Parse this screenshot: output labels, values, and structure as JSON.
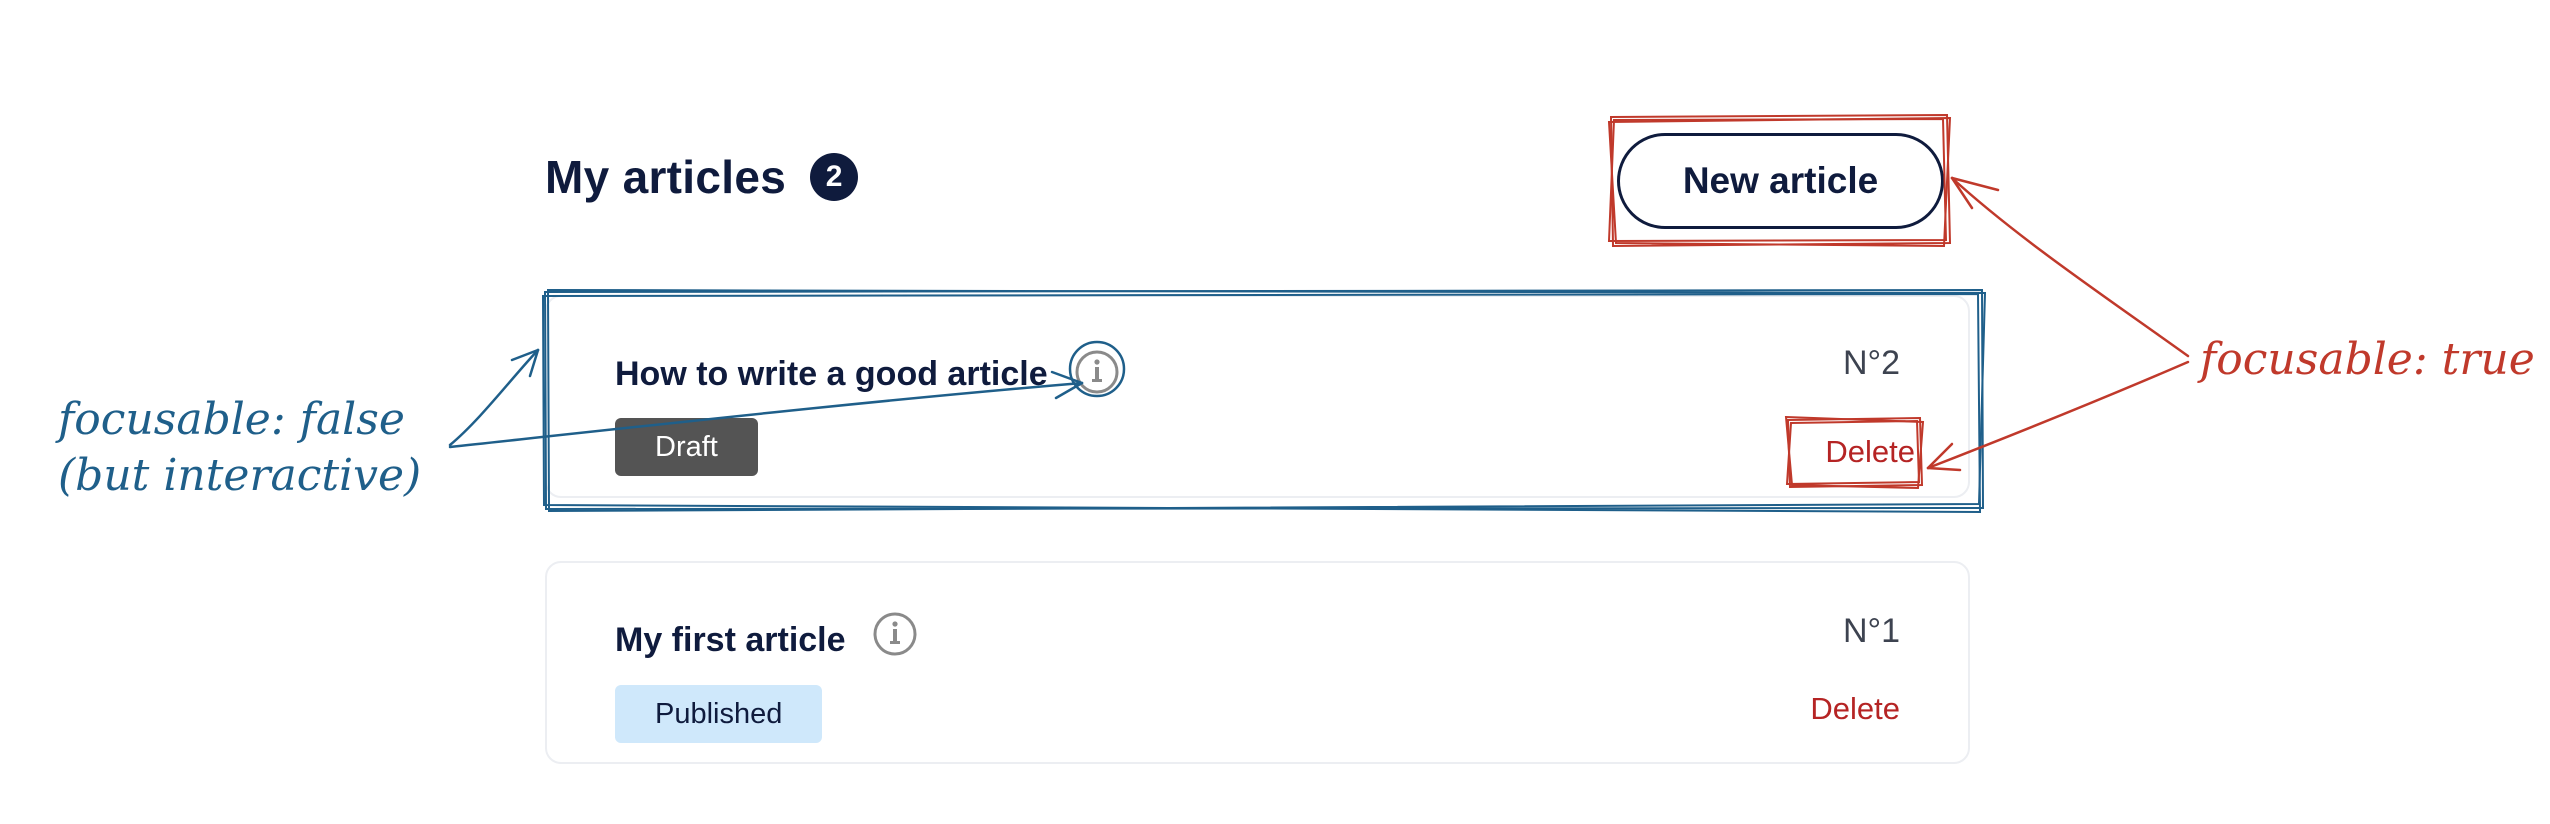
{
  "header": {
    "title": "My articles",
    "count": "2",
    "new_button": "New article"
  },
  "articles": [
    {
      "title": "How to write a good article",
      "number": "N°2",
      "status": "Draft",
      "delete_label": "Delete"
    },
    {
      "title": "My first article",
      "number": "N°1",
      "status": "Published",
      "delete_label": "Delete"
    }
  ],
  "annotations": {
    "left_line1": "focusable: false",
    "left_line2": "(but interactive)",
    "right": "focusable: true",
    "left_color": "#1f5f8a",
    "right_color": "#c0392b"
  },
  "icons": [
    "info-icon"
  ]
}
